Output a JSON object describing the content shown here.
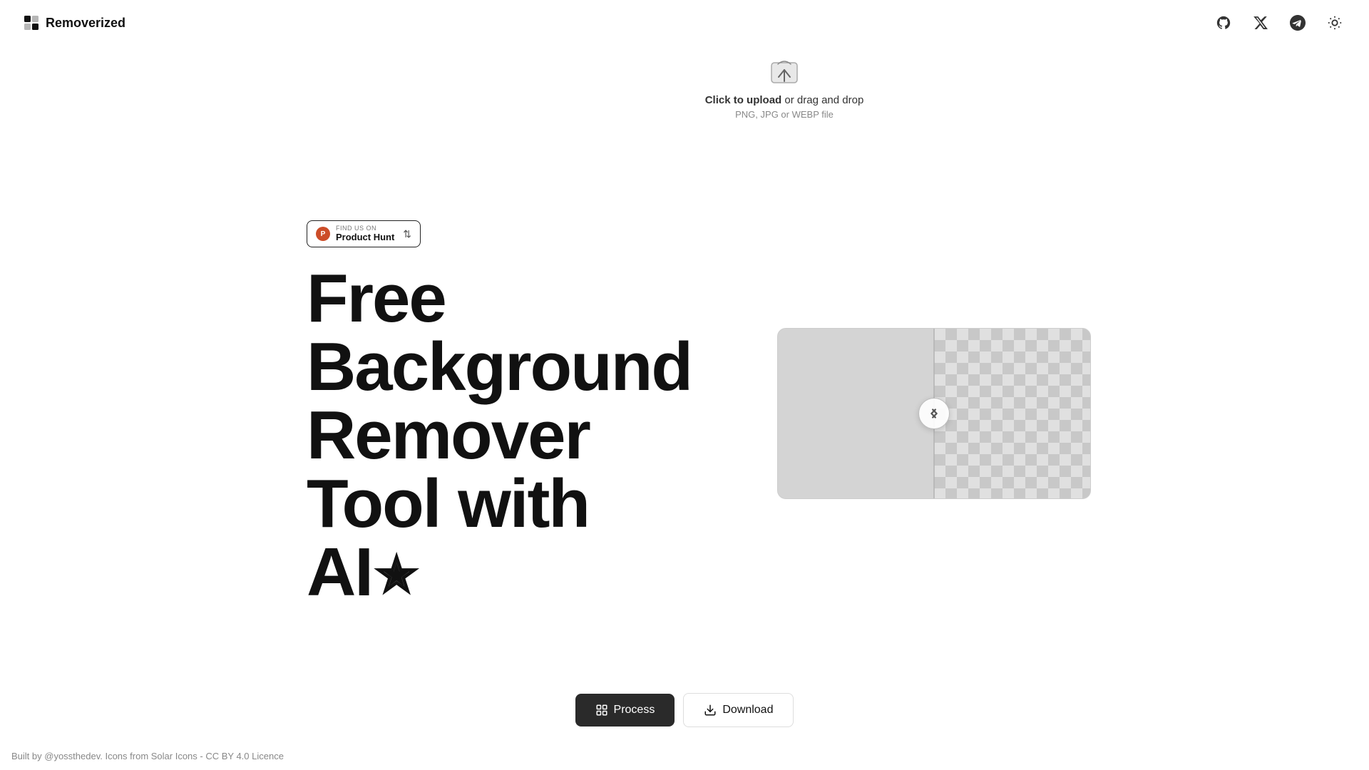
{
  "app": {
    "name": "Removerized"
  },
  "nav": {
    "github_label": "GitHub",
    "twitter_label": "Twitter/X",
    "telegram_label": "Telegram",
    "theme_label": "Toggle Theme"
  },
  "upload": {
    "click_text": "Click to upload",
    "drag_text": " or drag and drop",
    "subtext": "PNG, JPG or WEBP file"
  },
  "product_hunt": {
    "find_us": "FIND US ON",
    "name": "Product Hunt",
    "arrow": "⇅"
  },
  "hero": {
    "line1": "Free",
    "line2": "Background",
    "line3": "Remover",
    "line4": "Tool with",
    "line5": "AI"
  },
  "buttons": {
    "process": "Process",
    "download": "Download"
  },
  "footer": {
    "text": "Built by @yossthedev. Icons from Solar Icons - CC BY 4.0 Licence"
  }
}
